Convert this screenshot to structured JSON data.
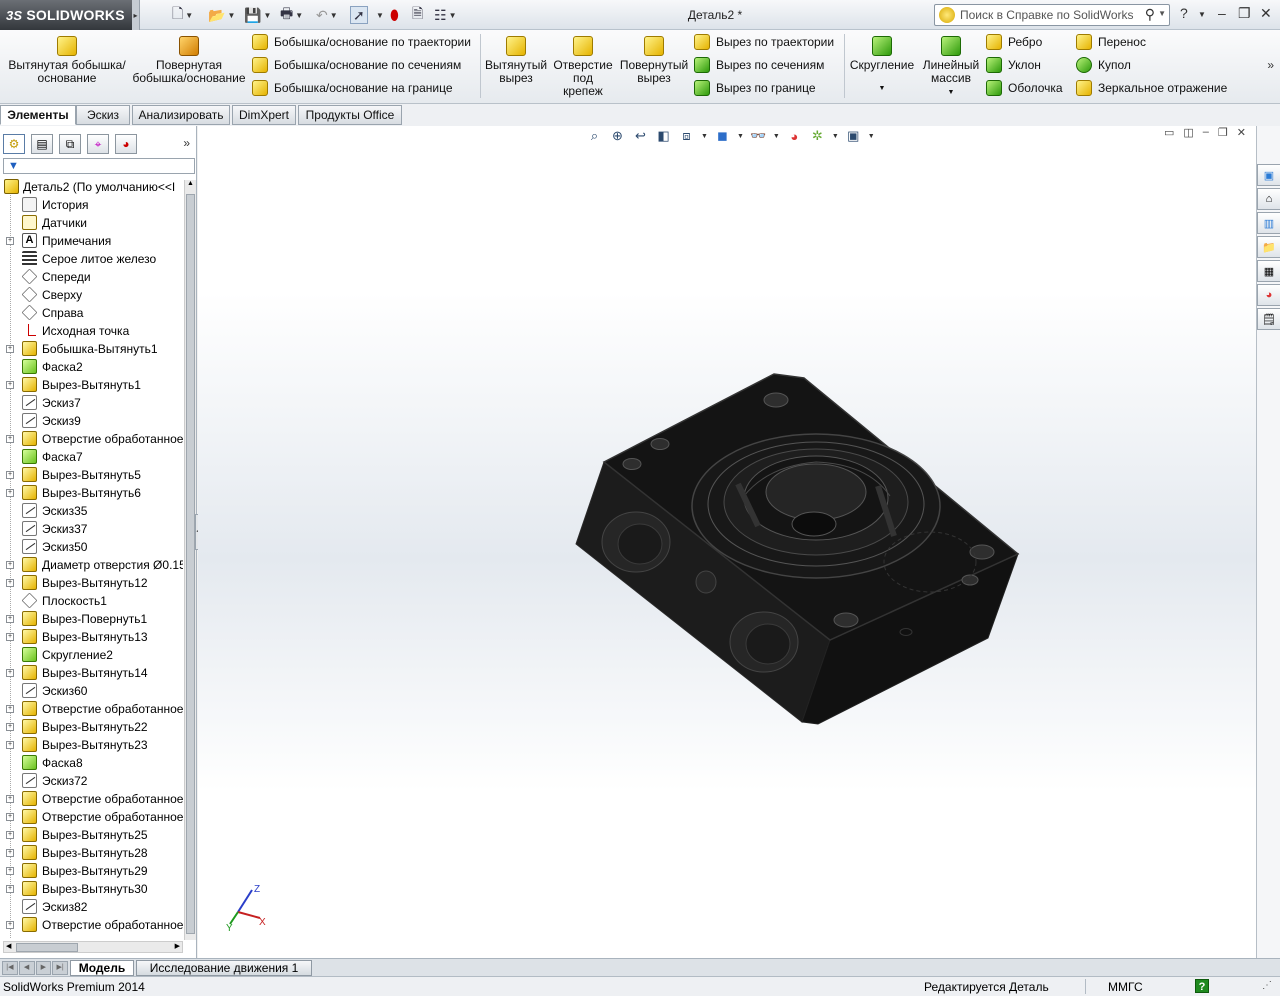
{
  "app": {
    "logo_prefix": "3S",
    "logo_text": "SOLIDWORKS",
    "doc_title": "Деталь2 *",
    "help_search_placeholder": "Поиск в Справке по SolidWorks"
  },
  "ribbon": {
    "extrude_boss": "Вытянутая бобышка/основание",
    "revolve_boss": "Повернутая бобышка/основание",
    "sweep_boss": "Бобышка/основание по траектории",
    "loft_boss": "Бобышка/основание по сечениям",
    "boundary_boss": "Бобышка/основание на границе",
    "extrude_cut": "Вытянутый вырез",
    "hole_wizard": "Отверстие под крепеж",
    "revolve_cut": "Повернутый вырез",
    "sweep_cut": "Вырез по траектории",
    "loft_cut": "Вырез по сечениям",
    "boundary_cut": "Вырез по границе",
    "fillet": "Скругление",
    "linear_pattern": "Линейный массив",
    "rib": "Ребро",
    "draft": "Уклон",
    "shell": "Оболочка",
    "wrap": "Перенос",
    "dome": "Купол",
    "mirror": "Зеркальное отражение"
  },
  "command_tabs": [
    "Элементы",
    "Эскиз",
    "Анализировать",
    "DimXpert",
    "Продукты Office"
  ],
  "tree": {
    "root": "Деталь2  (По умолчанию<<I",
    "items": [
      {
        "label": "История",
        "icon": "history-icon"
      },
      {
        "label": "Датчики",
        "icon": "sensors-icon"
      },
      {
        "label": "Примечания",
        "icon": "annotations-icon"
      },
      {
        "label": "Серое литое железо",
        "icon": "material-icon"
      },
      {
        "label": "Спереди",
        "icon": "plane-icon"
      },
      {
        "label": "Сверху",
        "icon": "plane-icon"
      },
      {
        "label": "Справа",
        "icon": "plane-icon"
      },
      {
        "label": "Исходная точка",
        "icon": "origin-icon"
      },
      {
        "label": "Бобышка-Вытянуть1",
        "icon": "extrude-icon"
      },
      {
        "label": "Фаска2",
        "icon": "chamfer-icon"
      },
      {
        "label": "Вырез-Вытянуть1",
        "icon": "cut-extrude-icon"
      },
      {
        "label": "Эскиз7",
        "icon": "sketch-icon"
      },
      {
        "label": "Эскиз9",
        "icon": "sketch-icon"
      },
      {
        "label": "Отверстие обработанное",
        "icon": "hole-icon"
      },
      {
        "label": "Фаска7",
        "icon": "chamfer-icon"
      },
      {
        "label": "Вырез-Вытянуть5",
        "icon": "cut-extrude-icon"
      },
      {
        "label": "Вырез-Вытянуть6",
        "icon": "cut-extrude-icon"
      },
      {
        "label": "Эскиз35",
        "icon": "sketch-icon"
      },
      {
        "label": "Эскиз37",
        "icon": "sketch-icon"
      },
      {
        "label": "Эскиз50",
        "icon": "sketch-icon"
      },
      {
        "label": "Диаметр отверстия Ø0.15",
        "icon": "hole-icon"
      },
      {
        "label": "Вырез-Вытянуть12",
        "icon": "cut-extrude-icon"
      },
      {
        "label": "Плоскость1",
        "icon": "plane-icon"
      },
      {
        "label": "Вырез-Повернуть1",
        "icon": "cut-revolve-icon"
      },
      {
        "label": "Вырез-Вытянуть13",
        "icon": "cut-extrude-icon"
      },
      {
        "label": "Скругление2",
        "icon": "fillet-icon"
      },
      {
        "label": "Вырез-Вытянуть14",
        "icon": "cut-extrude-icon"
      },
      {
        "label": "Эскиз60",
        "icon": "sketch-icon"
      },
      {
        "label": "Отверстие обработанное",
        "icon": "hole-icon"
      },
      {
        "label": "Вырез-Вытянуть22",
        "icon": "cut-extrude-icon"
      },
      {
        "label": "Вырез-Вытянуть23",
        "icon": "cut-extrude-icon"
      },
      {
        "label": "Фаска8",
        "icon": "chamfer-icon"
      },
      {
        "label": "Эскиз72",
        "icon": "sketch-icon"
      },
      {
        "label": "Отверстие обработанное",
        "icon": "hole-icon"
      },
      {
        "label": "Отверстие обработанное",
        "icon": "hole-icon"
      },
      {
        "label": "Вырез-Вытянуть25",
        "icon": "cut-extrude-icon"
      },
      {
        "label": "Вырез-Вытянуть28",
        "icon": "cut-extrude-icon"
      },
      {
        "label": "Вырез-Вытянуть29",
        "icon": "cut-extrude-icon"
      },
      {
        "label": "Вырез-Вытянуть30",
        "icon": "cut-extrude-icon"
      },
      {
        "label": "Эскиз82",
        "icon": "sketch-icon"
      },
      {
        "label": "Отверстие обработанное",
        "icon": "hole-icon"
      }
    ]
  },
  "bottom_tabs": [
    "Модель",
    "Исследование движения 1"
  ],
  "status": {
    "product": "SolidWorks Premium 2014",
    "state": "Редактируется Деталь",
    "units": "ММГС",
    "help": "?"
  },
  "triad": {
    "x": "X",
    "y": "Y",
    "z": "Z"
  },
  "colors": {
    "accent": "#e5b300",
    "model": "#111111",
    "viewport_mid": "#e4e9ef"
  }
}
